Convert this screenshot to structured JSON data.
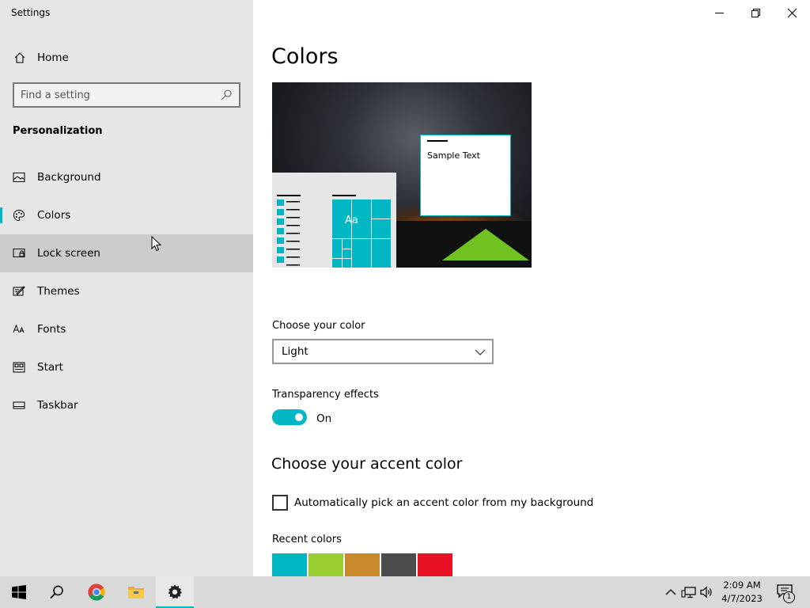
{
  "window": {
    "title": "Settings"
  },
  "sidebar": {
    "home_label": "Home",
    "search_placeholder": "Find a setting",
    "section_title": "Personalization",
    "items": [
      {
        "label": "Background",
        "icon": "picture-icon"
      },
      {
        "label": "Colors",
        "icon": "palette-icon",
        "selected": true
      },
      {
        "label": "Lock screen",
        "icon": "lock-screen-icon",
        "hovered": true
      },
      {
        "label": "Themes",
        "icon": "themes-icon"
      },
      {
        "label": "Fonts",
        "icon": "fonts-icon"
      },
      {
        "label": "Start",
        "icon": "start-icon"
      },
      {
        "label": "Taskbar",
        "icon": "taskbar-icon"
      }
    ]
  },
  "main": {
    "title": "Colors",
    "preview": {
      "sample_text": "Sample Text",
      "tile_text": "Aa"
    },
    "choose_color": {
      "label": "Choose your color",
      "value": "Light"
    },
    "transparency": {
      "label": "Transparency effects",
      "state": "On"
    },
    "accent": {
      "heading": "Choose your accent color",
      "auto_pick_label": "Automatically pick an accent color from my background",
      "recent_label": "Recent colors",
      "recent_colors": [
        "#00b7c3",
        "#9acd32",
        "#c8892b",
        "#4c4c4c",
        "#e81123"
      ]
    }
  },
  "colors": {
    "accent": "#00b7c3",
    "sidebar_bg": "#e6e6e6",
    "taskbar_bg": "#d9d9d9"
  },
  "taskbar": {
    "time": "2:09 AM",
    "date": "4/7/2023",
    "notification_count": "1"
  }
}
